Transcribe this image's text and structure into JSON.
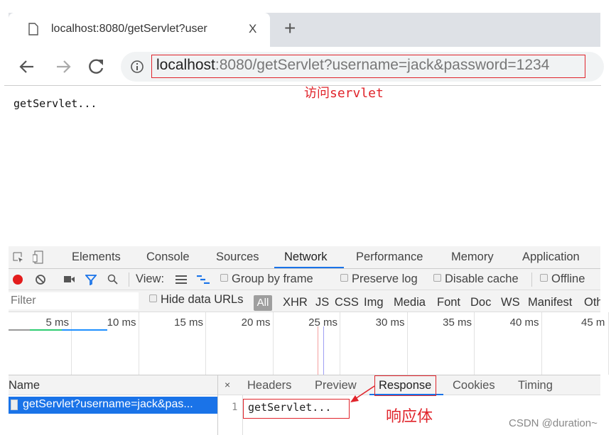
{
  "browser": {
    "tab_title": "localhost:8080/getServlet?user",
    "tab_close": "X",
    "new_tab": "+",
    "url_host": "localhost",
    "url_rest": ":8080/getServlet?username=jack&password=1234",
    "info_icon": "i"
  },
  "page": {
    "body_text": "getServlet..."
  },
  "annotations": {
    "url_note": "访问servlet",
    "response_note": "响应体",
    "color": "#e0242b"
  },
  "devtools": {
    "tabs": [
      "Elements",
      "Console",
      "Sources",
      "Network",
      "Performance",
      "Memory",
      "Application"
    ],
    "active_tab": "Network",
    "toolbar": {
      "view_label": "View:",
      "group_by_frame": "Group by frame",
      "preserve_log": "Preserve log",
      "disable_cache": "Disable cache",
      "offline": "Offline"
    },
    "filter": {
      "placeholder": "Filter",
      "hide_data_urls": "Hide data URLs",
      "types": [
        "All",
        "XHR",
        "JS",
        "CSS",
        "Img",
        "Media",
        "Font",
        "Doc",
        "WS",
        "Manifest",
        "Oth"
      ]
    },
    "timeline_ticks": [
      "5 ms",
      "10 ms",
      "15 ms",
      "20 ms",
      "25 ms",
      "30 ms",
      "35 ms",
      "40 ms",
      "45 m"
    ],
    "name_header": "Name",
    "request": "getServlet?username=jack&pas...",
    "detail_close": "×",
    "detail_tabs": [
      "Headers",
      "Preview",
      "Response",
      "Cookies",
      "Timing"
    ],
    "active_detail_tab": "Response",
    "response": {
      "line_number": "1",
      "content": "getServlet..."
    }
  },
  "watermark": "CSDN @duration~"
}
